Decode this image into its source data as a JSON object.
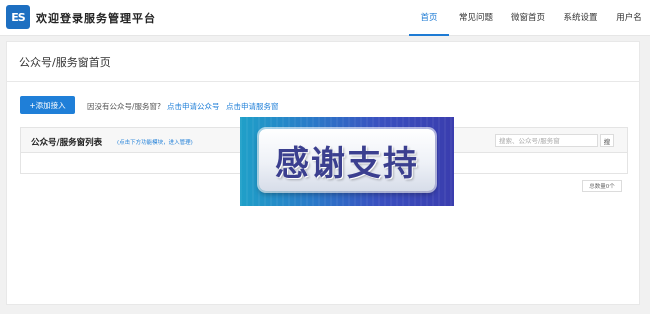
{
  "header": {
    "logo_text": "ES",
    "app_title": "欢迎登录服务管理平台",
    "nav": [
      {
        "label": "首页",
        "active": true
      },
      {
        "label": "常见问题",
        "active": false
      },
      {
        "label": "微窗首页",
        "active": false
      },
      {
        "label": "系统设置",
        "active": false
      },
      {
        "label": "用户名",
        "active": false
      }
    ]
  },
  "main": {
    "page_title": "公众号/服务窗首页",
    "add_button": "+添加接入",
    "hint_text": "因没有公众号/服务窗?",
    "link_apply_public": "点击申请公众号",
    "link_apply_service": "点击申请服务窗",
    "list": {
      "title": "公众号/服务窗列表",
      "subhint": "(点击下方功能模块，进入管理)",
      "search_placeholder": "搜索、公众号/服务窗",
      "search_button": "搜"
    },
    "total_label": "总数量0个"
  },
  "overlay": {
    "text": "感谢支持"
  },
  "colors": {
    "accent": "#1f7fd8",
    "logo_bg": "#1d6fc1"
  }
}
